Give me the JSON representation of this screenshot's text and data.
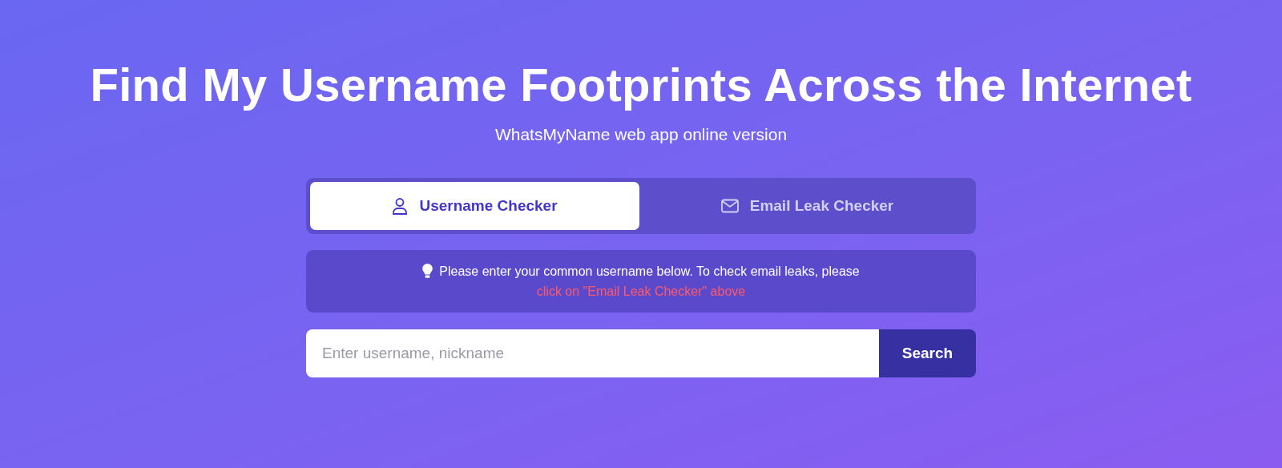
{
  "title": "Find My Username Footprints Across the Internet",
  "subtitle": "WhatsMyName web app online version",
  "tabs": [
    {
      "label": "Username Checker",
      "kind": "user",
      "selected": true
    },
    {
      "label": "Email Leak Checker",
      "kind": "mail",
      "selected": false
    }
  ],
  "notice": {
    "text": "Please enter your common username below. To check email leaks, please ",
    "link": "click on \"Email Leak Checker\" above"
  },
  "search": {
    "placeholder": "Enter username, nickname",
    "button": "Search"
  }
}
